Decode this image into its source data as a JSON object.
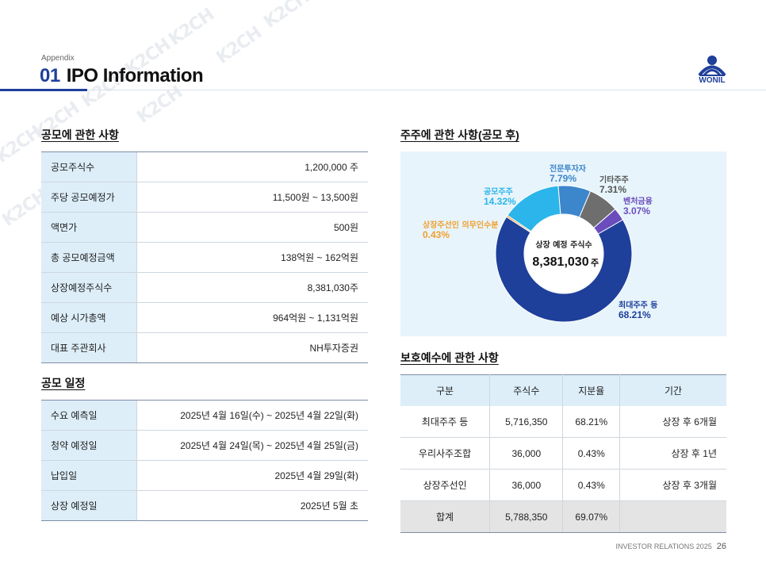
{
  "header": {
    "appendix": "Appendix",
    "number": "01",
    "title": "IPO Information",
    "logo_text": "WONIL",
    "brand_color": "#1e3f9a"
  },
  "offering": {
    "title": "공모에 관한 사항",
    "rows": [
      {
        "label": "공모주식수",
        "value": "1,200,000 주"
      },
      {
        "label": "주당 공모예정가",
        "value": "11,500원 ~ 13,500원"
      },
      {
        "label": "액면가",
        "value": "500원"
      },
      {
        "label": "총 공모예정금액",
        "value": "138억원 ~ 162억원"
      },
      {
        "label": "상장예정주식수",
        "value": "8,381,030주"
      },
      {
        "label": "예상 시가총액",
        "value": "964억원 ~ 1,131억원"
      },
      {
        "label": "대표 주관회사",
        "value": "NH투자증권"
      }
    ]
  },
  "schedule": {
    "title": "공모 일정",
    "rows": [
      {
        "label": "수요 예측일",
        "value": "2025년 4월 16일(수) ~ 2025년 4월 22일(화)"
      },
      {
        "label": "청약 예정일",
        "value": "2025년 4월 24일(목) ~ 2025년 4월 25일(금)"
      },
      {
        "label": "납입일",
        "value": "2025년 4월 29일(화)"
      },
      {
        "label": "상장 예정일",
        "value": "2025년 5월 초"
      }
    ]
  },
  "shareholders": {
    "title": "주주에 관한 사항(공모 후)",
    "center_label": "상장 예정 주식수",
    "center_value": "8,381,030",
    "center_unit": "주"
  },
  "chart_data": {
    "type": "pie",
    "donut": true,
    "slices": [
      {
        "name": "최대주주 등",
        "value": 68.21,
        "label": "68.21%",
        "color": "#1e3f9a"
      },
      {
        "name": "상장주선인 의무인수분",
        "value": 0.43,
        "label": "0.43%",
        "color": "#f0a030"
      },
      {
        "name": "공모주주",
        "value": 14.32,
        "label": "14.32%",
        "color": "#2bb5ea"
      },
      {
        "name": "전문투자자",
        "value": 7.79,
        "label": "7.79%",
        "color": "#3c86cc"
      },
      {
        "name": "기타주주",
        "value": 7.31,
        "label": "7.31%",
        "color": "#6e6e6e"
      },
      {
        "name": "벤처금융",
        "value": 3.07,
        "label": "3.07%",
        "color": "#6a4cbc"
      }
    ]
  },
  "lockup": {
    "title": "보호예수에 관한 사항",
    "headers": [
      "구분",
      "주식수",
      "지분율",
      "기간"
    ],
    "rows": [
      [
        "최대주주 등",
        "5,716,350",
        "68.21%",
        "상장 후 6개월"
      ],
      [
        "우리사주조합",
        "36,000",
        "0.43%",
        "상장 후 1년"
      ],
      [
        "상장주선인",
        "36,000",
        "0.43%",
        "상장 후 3개월"
      ]
    ],
    "total": [
      "합계",
      "5,788,350",
      "69.07%",
      ""
    ]
  },
  "footer": {
    "label": "INVESTOR RELATIONS 2025",
    "page": "26"
  }
}
